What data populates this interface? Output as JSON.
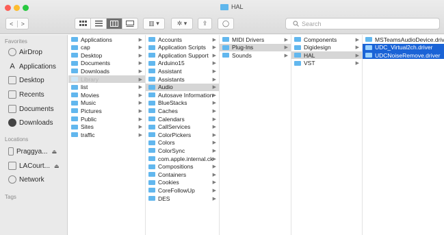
{
  "window": {
    "title": "HAL"
  },
  "toolbar": {
    "back": "<",
    "forward": ">",
    "views": [
      "icon-view",
      "list-view",
      "column-view",
      "gallery-view"
    ],
    "group": "▥ ▾",
    "action": "✲ ▾",
    "share": "⇪",
    "tag": "◯",
    "search_placeholder": "Search"
  },
  "sidebar": {
    "favorites_label": "Favorites",
    "favorites": [
      {
        "label": "AirDrop",
        "icon": "airdrop-icon"
      },
      {
        "label": "Applications",
        "icon": "applications-icon"
      },
      {
        "label": "Desktop",
        "icon": "desktop-icon"
      },
      {
        "label": "Recents",
        "icon": "recents-icon"
      },
      {
        "label": "Documents",
        "icon": "documents-icon"
      },
      {
        "label": "Downloads",
        "icon": "downloads-icon"
      }
    ],
    "locations_label": "Locations",
    "locations": [
      {
        "label": "Praggya...",
        "icon": "disk-icon",
        "eject": "⏏"
      },
      {
        "label": "LACourt...",
        "icon": "disk-icon",
        "eject": "⏏"
      },
      {
        "label": "Network",
        "icon": "network-icon"
      }
    ],
    "tags_label": "Tags"
  },
  "columns": [
    {
      "name": "home",
      "items": [
        {
          "label": "Applications",
          "chevron": true
        },
        {
          "label": "cap",
          "chevron": true
        },
        {
          "label": "Desktop",
          "chevron": true
        },
        {
          "label": "Documents",
          "chevron": true
        },
        {
          "label": "Downloads",
          "chevron": true
        },
        {
          "label": "Library",
          "chevron": true,
          "state": "grey-dim"
        },
        {
          "label": "list",
          "chevron": true
        },
        {
          "label": "Movies",
          "chevron": true
        },
        {
          "label": "Music",
          "chevron": true
        },
        {
          "label": "Pictures",
          "chevron": true
        },
        {
          "label": "Public",
          "chevron": true
        },
        {
          "label": "Sites",
          "chevron": true
        },
        {
          "label": "traffic",
          "chevron": true
        }
      ]
    },
    {
      "name": "library",
      "items": [
        {
          "label": "Accounts",
          "chevron": true
        },
        {
          "label": "Application Scripts",
          "chevron": true
        },
        {
          "label": "Application Support",
          "chevron": true
        },
        {
          "label": "Arduino15",
          "chevron": true
        },
        {
          "label": "Assistant",
          "chevron": true
        },
        {
          "label": "Assistants",
          "chevron": true
        },
        {
          "label": "Audio",
          "chevron": true,
          "state": "grey"
        },
        {
          "label": "Autosave Information",
          "chevron": true
        },
        {
          "label": "BlueStacks",
          "chevron": true
        },
        {
          "label": "Caches",
          "chevron": true
        },
        {
          "label": "Calendars",
          "chevron": true
        },
        {
          "label": "CallServices",
          "chevron": true
        },
        {
          "label": "ColorPickers",
          "chevron": true
        },
        {
          "label": "Colors",
          "chevron": true
        },
        {
          "label": "ColorSync",
          "chevron": true
        },
        {
          "label": "com.apple.internal.ck",
          "chevron": true
        },
        {
          "label": "Compositions",
          "chevron": true
        },
        {
          "label": "Containers",
          "chevron": true
        },
        {
          "label": "Cookies",
          "chevron": true
        },
        {
          "label": "CoreFollowUp",
          "chevron": true
        },
        {
          "label": "DES",
          "chevron": true
        }
      ]
    },
    {
      "name": "audio",
      "items": [
        {
          "label": "MIDI Drivers",
          "chevron": true
        },
        {
          "label": "Plug-Ins",
          "chevron": true,
          "state": "grey"
        },
        {
          "label": "Sounds",
          "chevron": true
        }
      ]
    },
    {
      "name": "plugins",
      "items": [
        {
          "label": "Components",
          "chevron": true
        },
        {
          "label": "Digidesign",
          "chevron": true
        },
        {
          "label": "HAL",
          "chevron": true,
          "state": "grey"
        },
        {
          "label": "VST",
          "chevron": true
        }
      ]
    },
    {
      "name": "hal",
      "items": [
        {
          "label": "MSTeamsAudioDevice.driver",
          "chevron": false
        },
        {
          "label": "UDC_Virtual2ch.driver",
          "chevron": false,
          "state": "blue"
        },
        {
          "label": "UDCNoiseRemove.driver",
          "chevron": false,
          "state": "blue"
        }
      ]
    }
  ],
  "colors": {
    "folder": "#62b7ee",
    "selection_blue": "#1a63d6",
    "selection_grey": "#d6d6d6",
    "sidebar_bg": "#eaeaea"
  }
}
